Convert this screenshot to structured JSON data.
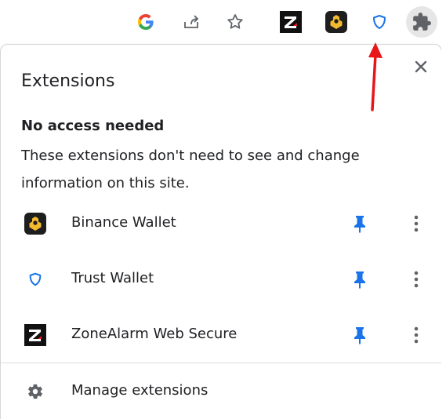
{
  "toolbar": {
    "icons": [
      "google-icon",
      "share-icon",
      "bookmark-star-icon",
      "zonealarm-icon",
      "binance-wallet-icon",
      "trust-wallet-shield-icon",
      "extensions-puzzle-icon"
    ]
  },
  "popup": {
    "title": "Extensions",
    "section_heading": "No access needed",
    "section_description": "These extensions don't need to see and change information on this site.",
    "extensions": [
      {
        "name": "Binance Wallet",
        "icon": "binance-wallet-icon",
        "pinned": true
      },
      {
        "name": "Trust Wallet",
        "icon": "trust-wallet-shield-icon",
        "pinned": true
      },
      {
        "name": "ZoneAlarm Web Secure",
        "icon": "zonealarm-icon",
        "pinned": true
      }
    ],
    "manage_label": "Manage extensions"
  },
  "colors": {
    "pin_blue": "#1a73e8",
    "annotation_arrow_red": "#e8151b",
    "binance_yellow": "#f3ba2f",
    "text_dark": "#202124"
  }
}
